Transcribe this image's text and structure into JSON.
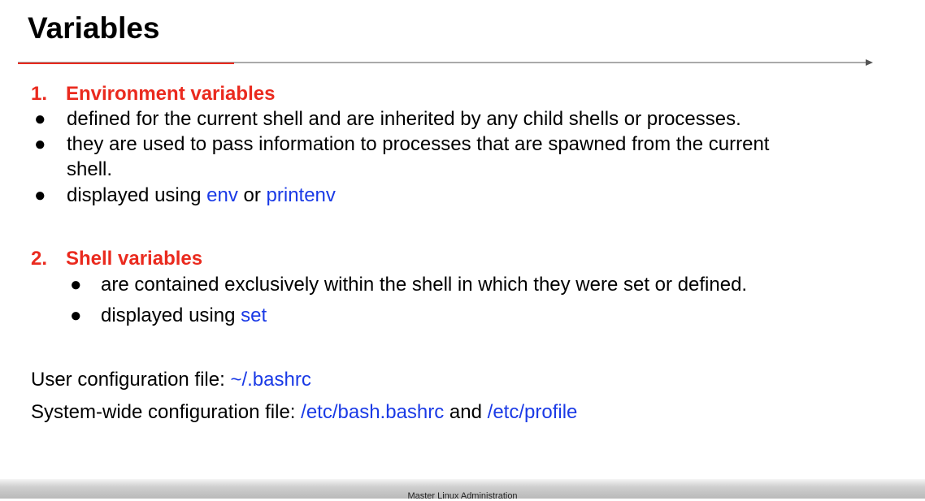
{
  "slide": {
    "title": "Variables"
  },
  "sections": [
    {
      "number": "1.",
      "heading": "Environment variables",
      "bullets": [
        "defined for the current shell and are inherited by any child shells or processes.",
        "they are used to pass information to processes that are spawned from the current",
        "shell.",
        "displayed using "
      ],
      "commands": [
        "env",
        " or ",
        "printenv"
      ]
    },
    {
      "number": "2.",
      "heading": "Shell variables",
      "bullets": [
        "are contained exclusively within the shell in which they were set or defined.",
        "displayed using "
      ],
      "commands": [
        "set"
      ]
    }
  ],
  "config": {
    "user_label": "User configuration file: ",
    "user_path": "~/.bashrc",
    "system_label": "System-wide configuration file: ",
    "system_path1": "/etc/bash.bashrc",
    "system_and": " and ",
    "system_path2": "/etc/profile"
  },
  "footer": {
    "text": "Master Linux Administration"
  },
  "colors": {
    "heading": "#ea2a1e",
    "command": "#1a3ae6",
    "rule_accent": "#ea2a1e",
    "rule_line": "#555555"
  }
}
